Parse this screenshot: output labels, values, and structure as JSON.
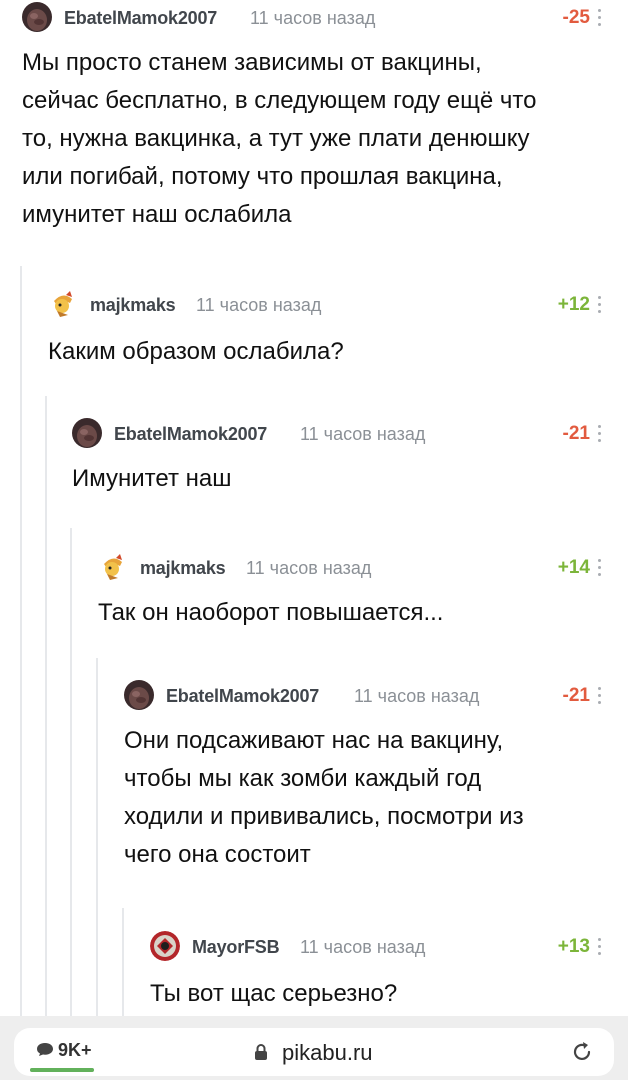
{
  "comments": [
    {
      "username": "EbatelMamok2007",
      "timestamp": "11 часов назад",
      "rating": "-25",
      "text": [
        "Мы просто станем зависимы от вакцины,",
        "сейчас бесплатно, в следующем году ещё что",
        "то, нужна вакцинка, а тут уже плати денюшку",
        "или погибай, потому что прошлая вакцина,",
        "имунитет наш ослабила"
      ]
    },
    {
      "username": "majkmaks",
      "timestamp": "11 часов назад",
      "rating": "+12",
      "text": [
        "Каким образом ослабила?"
      ]
    },
    {
      "username": "EbatelMamok2007",
      "timestamp": "11 часов назад",
      "rating": "-21",
      "text": [
        "Имунитет наш"
      ]
    },
    {
      "username": "majkmaks",
      "timestamp": "11 часов назад",
      "rating": "+14",
      "text": [
        "Так он наоборот повышается..."
      ]
    },
    {
      "username": "EbatelMamok2007",
      "timestamp": "11 часов назад",
      "rating": "-21",
      "text": [
        "Они подсаживают нас на вакцину,",
        "чтобы мы как зомби каждый год",
        "ходили и прививались, посмотри из",
        "чего она состоит"
      ]
    },
    {
      "username": "MayorFSB",
      "timestamp": "11 часов назад",
      "rating": "+13",
      "text": [
        "Ты вот щас серьезно?"
      ]
    }
  ],
  "browser": {
    "comment_count": "9K+",
    "url": "pikabu.ru",
    "progress": 1.0
  },
  "colors": {
    "negative_rating": "#e25b3f",
    "positive_rating": "#7cb53a",
    "thread_line": "#e6e8eb"
  }
}
